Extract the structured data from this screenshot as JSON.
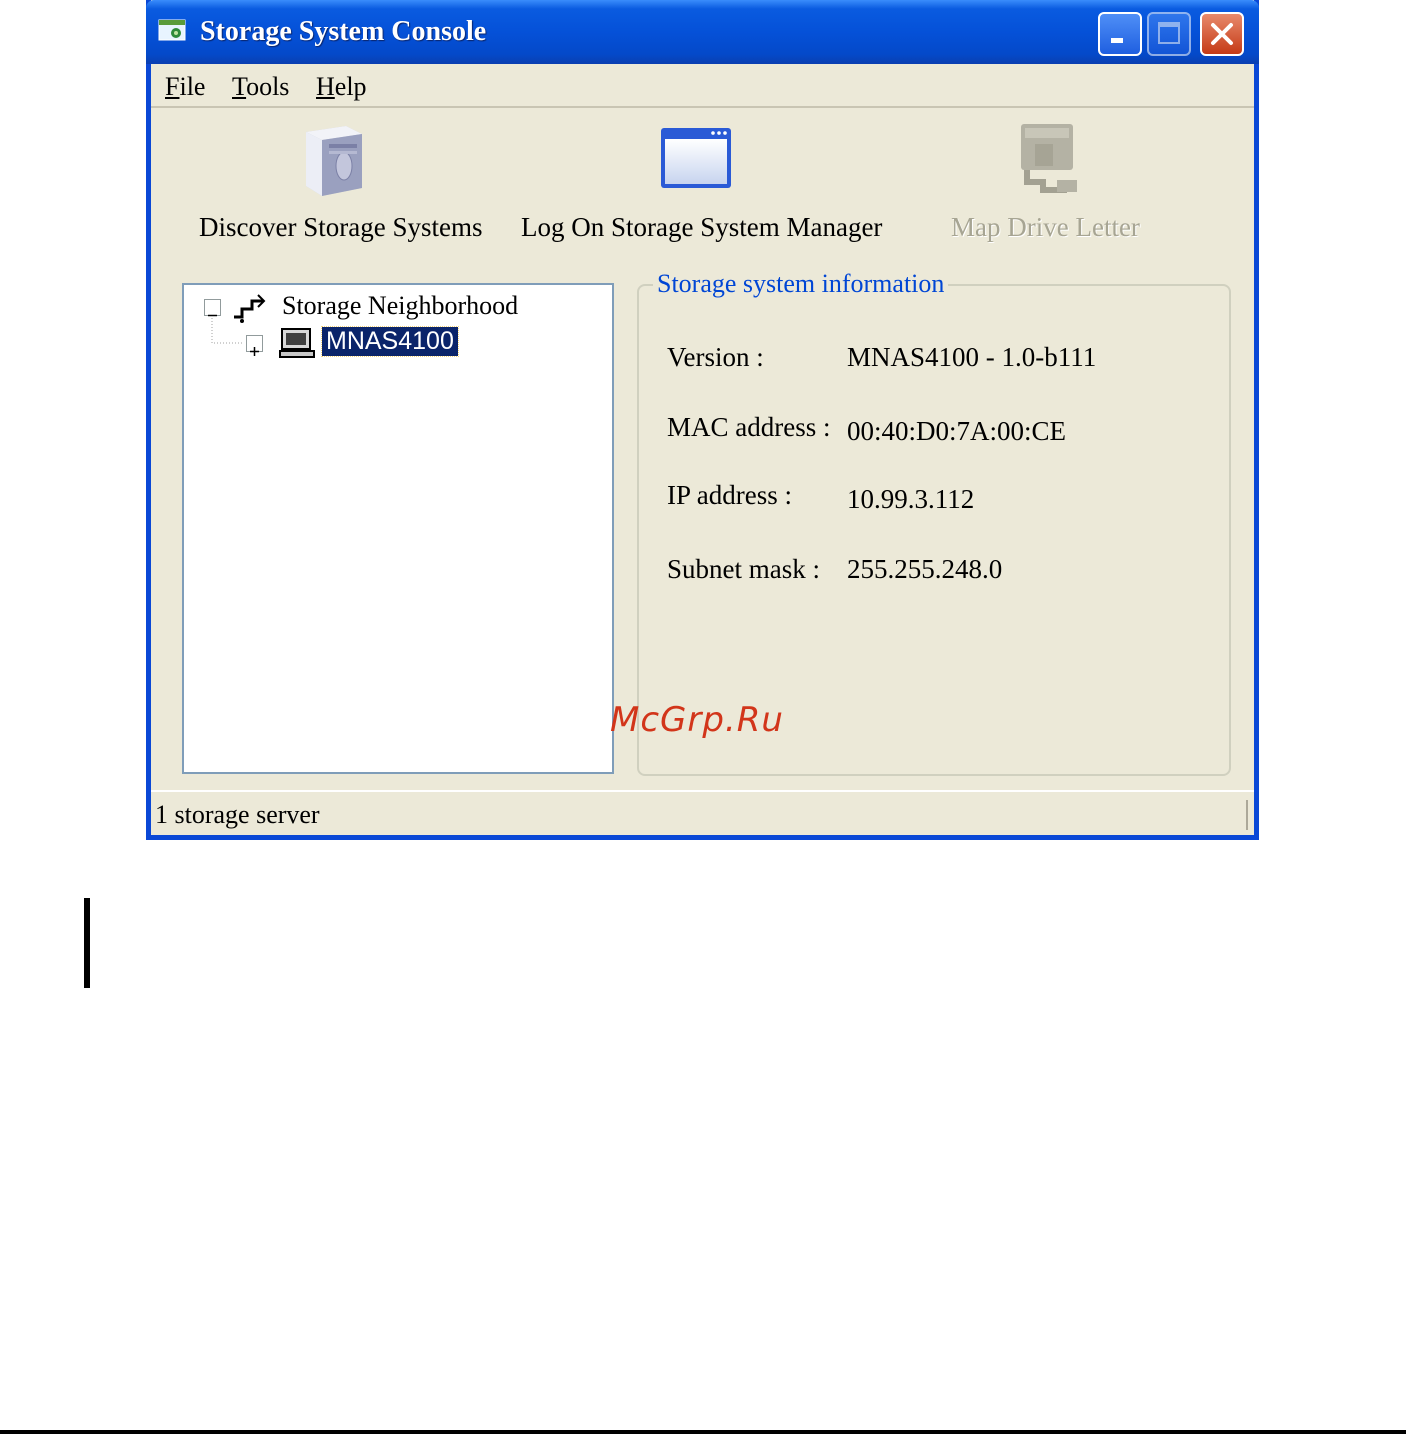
{
  "window": {
    "title": "Storage System Console",
    "controls": {
      "minimize_icon": "minimize-icon",
      "maximize_icon": "maximize-icon",
      "close_icon": "close-icon"
    }
  },
  "menu": {
    "file": {
      "accel": "F",
      "rest": "ile"
    },
    "tools": {
      "accel": "T",
      "rest": "ools"
    },
    "help": {
      "accel": "H",
      "rest": "elp"
    }
  },
  "toolbar": {
    "discover": {
      "label": "Discover Storage Systems",
      "icon": "storage-server-icon",
      "enabled": true
    },
    "logon": {
      "label": "Log On Storage System Manager",
      "icon": "window-icon",
      "enabled": true
    },
    "map_drive": {
      "label": "Map Drive Letter",
      "icon": "network-drive-icon",
      "enabled": false
    }
  },
  "tree": {
    "root": {
      "label": "Storage Neighborhood",
      "icon": "network-icon",
      "expander": "collapse"
    },
    "child": {
      "label": "MNAS4100",
      "icon": "computer-icon",
      "expander": "expand",
      "selected": true
    }
  },
  "info": {
    "title": "Storage system information",
    "version": {
      "label": "Version :",
      "value": "MNAS4100 - 1.0-b111"
    },
    "mac": {
      "label": "MAC address :",
      "value": "00:40:D0:7A:00:CE"
    },
    "ip": {
      "label": "IP address :",
      "value": "10.99.3.112"
    },
    "subnet": {
      "label": "Subnet mask :",
      "value": "255.255.248.0"
    }
  },
  "status": {
    "text": "1 storage server"
  },
  "watermark": "McGrp.Ru",
  "colors": {
    "titlebar": "#0551d8",
    "selection": "#0a246a",
    "group_title": "#0046d5",
    "disabled_text": "#a7a593",
    "watermark": "#d2351a"
  }
}
